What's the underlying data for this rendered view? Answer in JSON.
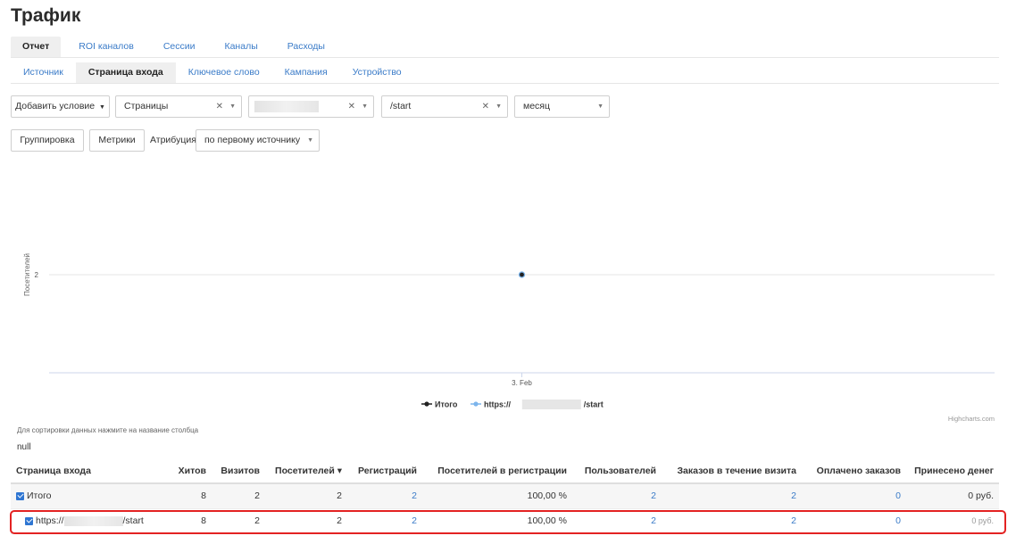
{
  "page": {
    "title": "Трафик"
  },
  "tabs_primary": [
    {
      "label": "Отчет",
      "active": true
    },
    {
      "label": "ROI каналов",
      "active": false
    },
    {
      "label": "Сессии",
      "active": false
    },
    {
      "label": "Каналы",
      "active": false
    },
    {
      "label": "Расходы",
      "active": false
    }
  ],
  "tabs_secondary": [
    {
      "label": "Источник",
      "active": false
    },
    {
      "label": "Страница входа",
      "active": true
    },
    {
      "label": "Ключевое слово",
      "active": false
    },
    {
      "label": "Кампания",
      "active": false
    },
    {
      "label": "Устройство",
      "active": false
    }
  ],
  "filters": {
    "add_condition": "Добавить условие",
    "dim_select": "Страницы",
    "operator_select": "",
    "value_select": "/start",
    "period_select": "месяц"
  },
  "toolbar": {
    "grouping": "Группировка",
    "metrics": "Метрики",
    "attribution_label": "Атрибуция",
    "attribution_value": "по первому источнику"
  },
  "chart_data": {
    "type": "line",
    "ylabel": "Посетителей",
    "x_categories": [
      "3. Feb"
    ],
    "yticks": [
      2
    ],
    "series": [
      {
        "name": "Итого",
        "values": [
          2
        ],
        "color": "#222222"
      },
      {
        "name": "https://",
        "name_suffix": "/start",
        "values": [
          2
        ],
        "color": "#7cb5ec"
      }
    ],
    "credit": "Highcharts.com"
  },
  "hint": "Для сортировки данных нажмите на название столбца",
  "null_text": "null",
  "table": {
    "columns": [
      "Страница входа",
      "Хитов",
      "Визитов",
      "Посетителей ▾",
      "Регистраций",
      "Посетителей в регистрации",
      "Пользователей",
      "Заказов в течение визита",
      "Оплачено заказов",
      "Принесено денег"
    ],
    "rows": [
      {
        "name": "Итого",
        "name_suffix": "",
        "hits": "8",
        "visits": "2",
        "visitors": "2",
        "registrations": "2",
        "reg_rate": "100,00 %",
        "users": "2",
        "orders": "2",
        "paid": "0",
        "money": "0 руб."
      },
      {
        "name": "https://",
        "name_suffix": "/start",
        "hits": "8",
        "visits": "2",
        "visitors": "2",
        "registrations": "2",
        "reg_rate": "100,00 %",
        "users": "2",
        "orders": "2",
        "paid": "0",
        "money": "0 руб."
      }
    ]
  },
  "colors": {
    "link": "#3a7bc8",
    "highlight": "#e32222",
    "checkbox": "#2f76d2"
  }
}
